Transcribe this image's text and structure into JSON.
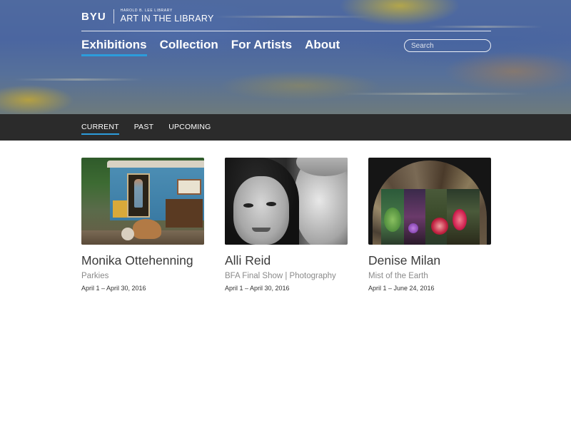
{
  "header": {
    "logo": {
      "mark": "BYU",
      "sub_label": "HAROLD B. LEE LIBRARY",
      "main_label": "ART IN THE LIBRARY"
    },
    "nav": [
      {
        "label": "Exhibitions",
        "active": true
      },
      {
        "label": "Collection",
        "active": false
      },
      {
        "label": "For Artists",
        "active": false
      },
      {
        "label": "About",
        "active": false
      }
    ],
    "search": {
      "placeholder": "Search",
      "value": ""
    }
  },
  "subnav": [
    {
      "label": "CURRENT",
      "active": true
    },
    {
      "label": "PAST",
      "active": false
    },
    {
      "label": "UPCOMING",
      "active": false
    }
  ],
  "exhibitions": [
    {
      "title": "Monika Ottehenning",
      "subtitle": "Parkies",
      "dates": "April 1 – April 30, 2016",
      "image": "trailer-porch-photo"
    },
    {
      "title": "Alli Reid",
      "subtitle": "BFA Final Show | Photography",
      "dates": "April 1 – April 30, 2016",
      "image": "black-and-white-portrait-photo"
    },
    {
      "title": "Denise Milan",
      "subtitle": "Mist of the Earth",
      "dates": "April 1 – June 24, 2016",
      "image": "botanical-collage-photo"
    }
  ],
  "colors": {
    "accent": "#2c9cdb",
    "subnav_bg": "#2b2b2b",
    "title_text": "#3a3a3a",
    "subtitle_text": "#8a8a8a"
  }
}
